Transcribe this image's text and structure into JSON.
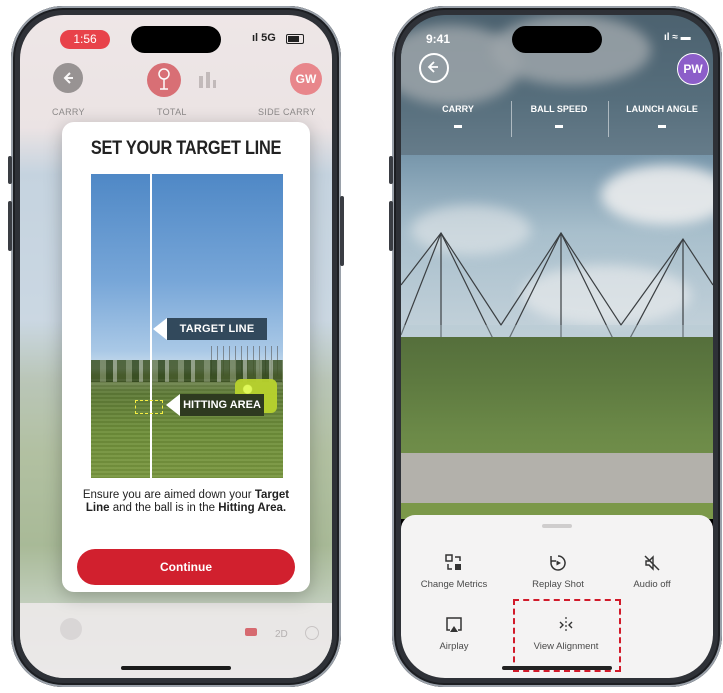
{
  "left_phone": {
    "status": {
      "time": "1:56",
      "signal": "5G"
    },
    "header": {
      "avatar": "GW",
      "metrics": [
        "CARRY",
        "TOTAL",
        "SIDE CARRY"
      ]
    },
    "modal": {
      "title": "SET YOUR TARGET LINE",
      "tag_target": "TARGET LINE",
      "tag_hitting": "HITTING AREA",
      "text_1": "Ensure you are aimed down your ",
      "text_bold_1": "Target Line",
      "text_2": " and the ball is in the ",
      "text_bold_2": "Hitting Area.",
      "continue_label": "Continue"
    },
    "bottom_bar": {
      "mode_2d": "2D"
    }
  },
  "right_phone": {
    "status": {
      "time": "9:41"
    },
    "header": {
      "avatar": "PW",
      "metrics": [
        {
          "label": "CARRY",
          "value": "-"
        },
        {
          "label": "BALL SPEED",
          "value": "-"
        },
        {
          "label": "LAUNCH ANGLE",
          "value": "-"
        }
      ]
    },
    "sheet": {
      "items": [
        {
          "label": "Change Metrics",
          "icon": "change-metrics-icon"
        },
        {
          "label": "Replay Shot",
          "icon": "replay-icon"
        },
        {
          "label": "Audio off",
          "icon": "audio-off-icon"
        },
        {
          "label": "Airplay",
          "icon": "airplay-icon"
        },
        {
          "label": "View Alignment",
          "icon": "alignment-icon"
        }
      ],
      "highlight_color": "#d11a2a"
    }
  },
  "colors": {
    "brand_red": "#d1202e",
    "avatar_purple": "#8c5ec9"
  }
}
